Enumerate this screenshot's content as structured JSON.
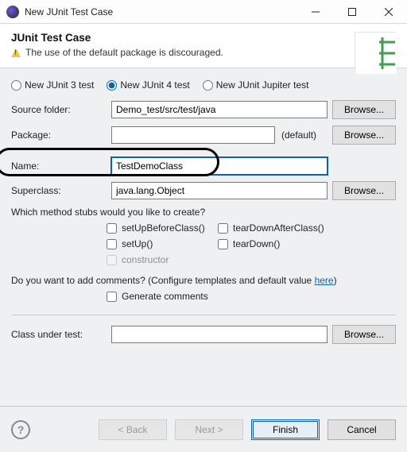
{
  "window": {
    "title": "New JUnit Test Case"
  },
  "header": {
    "heading": "JUnit Test Case",
    "warning": "The use of the default package is discouraged."
  },
  "radios": {
    "junit3": "New JUnit 3 test",
    "junit4": "New JUnit 4 test",
    "jupiter": "New JUnit Jupiter test",
    "selected": "junit4"
  },
  "fields": {
    "sourceFolder": {
      "label": "Source folder:",
      "value": "Demo_test/src/test/java",
      "browse": "Browse..."
    },
    "package": {
      "label": "Package:",
      "value": "",
      "hint": "(default)",
      "browse": "Browse..."
    },
    "name": {
      "label": "Name:",
      "value": "TestDemoClass"
    },
    "superclass": {
      "label": "Superclass:",
      "value": "java.lang.Object",
      "browse": "Browse..."
    },
    "classUnderTest": {
      "label": "Class under test:",
      "value": "",
      "browse": "Browse..."
    }
  },
  "stubs": {
    "question": "Which method stubs would you like to create?",
    "setUpBeforeClass": "setUpBeforeClass()",
    "tearDownAfterClass": "tearDownAfterClass()",
    "setUp": "setUp()",
    "tearDown": "tearDown()",
    "constructor": "constructor"
  },
  "comments": {
    "question_a": "Do you want to add comments? (Configure templates and default value ",
    "here": "here",
    "question_b": ")",
    "generate": "Generate comments"
  },
  "footer": {
    "back": "< Back",
    "next": "Next >",
    "finish": "Finish",
    "cancel": "Cancel"
  }
}
